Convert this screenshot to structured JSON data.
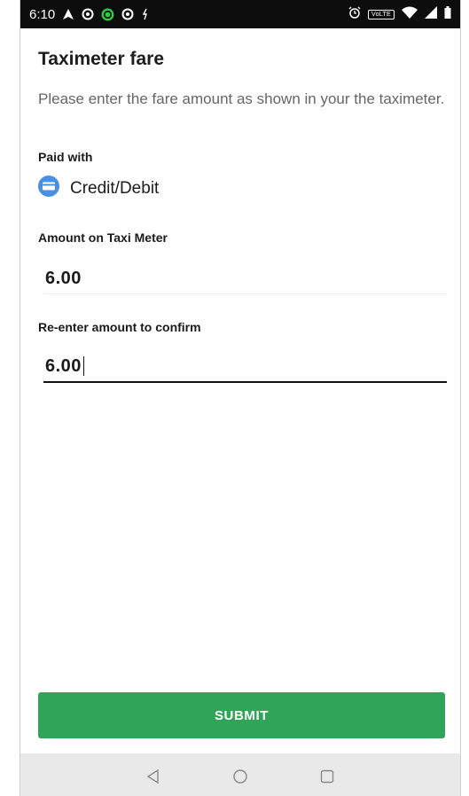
{
  "status_bar": {
    "time": "6:10",
    "carrier_badge": "VoLTE",
    "icons": [
      "navigation-icon",
      "location-icon",
      "location-active-icon",
      "location-icon",
      "key-icon",
      "alarm-icon",
      "wifi-icon",
      "signal-icon",
      "battery-icon"
    ]
  },
  "page": {
    "title": "Taximeter fare",
    "description": "Please enter the fare amount as shown in your the taximeter."
  },
  "payment": {
    "label": "Paid with",
    "method": "Credit/Debit",
    "icon": "credit-card-icon",
    "icon_color": "#4a90e2"
  },
  "amount_field": {
    "label": "Amount on Taxi Meter",
    "value": "6.00"
  },
  "confirm_field": {
    "label": "Re-enter amount to confirm",
    "value": "6.00"
  },
  "submit": {
    "label": "SUBMIT",
    "color": "#30a55a"
  },
  "nav_bar": {
    "icons": [
      "back-icon",
      "home-icon",
      "recents-icon"
    ]
  }
}
